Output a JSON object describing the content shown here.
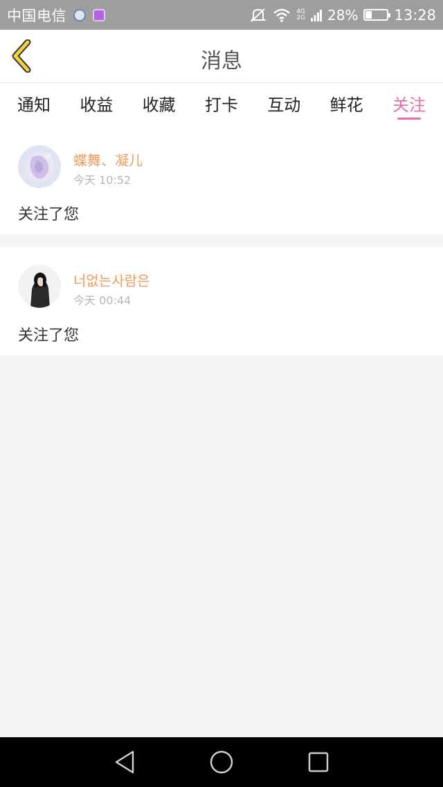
{
  "status_bar": {
    "carrier": "中国电信",
    "network_top": "4G",
    "network_bottom": "2G",
    "battery_percent_text": "28%",
    "battery_level": 0.28,
    "time": "13:28"
  },
  "header": {
    "title": "消息"
  },
  "tabs": [
    {
      "label": "通知",
      "active": false
    },
    {
      "label": "收益",
      "active": false
    },
    {
      "label": "收藏",
      "active": false
    },
    {
      "label": "打卡",
      "active": false
    },
    {
      "label": "互动",
      "active": false
    },
    {
      "label": "鲜花",
      "active": false
    },
    {
      "label": "关注",
      "active": true
    }
  ],
  "messages": [
    {
      "username": "蝶舞、凝儿",
      "time": "今天 10:52",
      "text": "关注了您"
    },
    {
      "username": "너없는사람은",
      "time": "今天 00:44",
      "text": "关注了您"
    }
  ],
  "colors": {
    "accent": "#e96ea8",
    "username": "#f09a58",
    "back_arrow": "#f2d43a"
  }
}
